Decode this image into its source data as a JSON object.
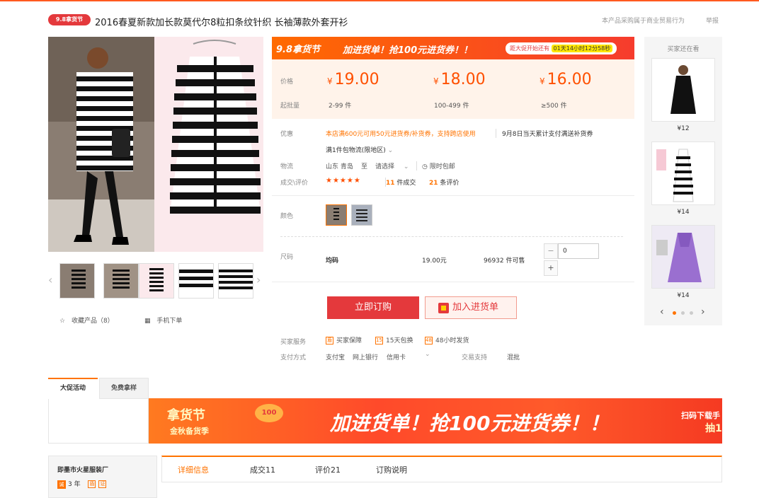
{
  "header": {
    "badge": "9.8拿货节",
    "title": "2016春夏新款加长款莫代尔8粒扣条纹针织 长袖薄款外套开衫",
    "trade_note": "本产品采购属于商业贸易行为",
    "report": "举报"
  },
  "gallery": {
    "favorite_label": "收藏产品（8）",
    "mobile_order_label": "手机下单"
  },
  "promo": {
    "festival": "9.8拿货节",
    "slogan": "加进货单！抢100元进货券！！",
    "countdown_label": "距大促开始还有",
    "countdown_value": "01天14小时12分58秒"
  },
  "pricing": {
    "price_label": "价格",
    "moq_label": "起批量",
    "currency": "¥",
    "tiers": [
      {
        "price": "19.00",
        "range": "2-99 件"
      },
      {
        "price": "18.00",
        "range": "100-499 件"
      },
      {
        "price": "16.00",
        "range": "≥500 件"
      }
    ]
  },
  "info": {
    "discount_label": "优惠",
    "discount_text": "本店满600元可用50元进货券/补货券，支持跨店使用",
    "discount_extra": "9月8日当天累计支付满送补货券",
    "freeshipping": "满1件包物流(限地区)",
    "logistics_label": "物流",
    "from": "山东 青岛",
    "to_word": "至",
    "dest_placeholder": "请选择",
    "free_ship": "限时包邮",
    "deals_label": "成交\\评价",
    "stars": "★★★★★",
    "deals_count": "11",
    "deals_unit": "件成交",
    "reviews_count": "21",
    "reviews_unit": "条评价",
    "color_label": "颜色",
    "size_label": "尺码",
    "size_value": "均码",
    "size_price": "19.00元",
    "stock": "96932 件可售",
    "qty_value": "0",
    "qty_minus": "−",
    "qty_plus": "+"
  },
  "actions": {
    "order": "立即订购",
    "cart": "加入进货单"
  },
  "service": {
    "buyer_service_label": "买家服务",
    "items": [
      "买家保障",
      "15天包换",
      "48小时发货"
    ],
    "pay_label": "支付方式",
    "pay_methods": [
      "支付宝",
      "网上银行",
      "信用卡"
    ],
    "trade_support_label": "交易支持",
    "trade_support_value": "混批"
  },
  "sidebar": {
    "title": "买家还在看",
    "items": [
      {
        "price": "¥12"
      },
      {
        "price": "¥14"
      },
      {
        "price": "¥14"
      }
    ],
    "prev": "‹",
    "next": "›"
  },
  "lower": {
    "tab_promo": "大促活动",
    "tab_sample": "免费拿样",
    "banner_left1": "拿货节",
    "banner_left2": "金秋备货季",
    "banner_main": "加进货单！抢100元进货券！！",
    "banner_coin": "100",
    "banner_right1": "扫码下载手",
    "banner_right2": "抽1",
    "shop_name": "即墨市火星服装厂",
    "shop_years": "3 年",
    "detail_tabs": [
      "详细信息",
      "成交11",
      "评价21",
      "订购说明"
    ]
  },
  "colors": {
    "accent": "#ff5000",
    "red": "#e4393c",
    "orange": "#ff7300"
  }
}
